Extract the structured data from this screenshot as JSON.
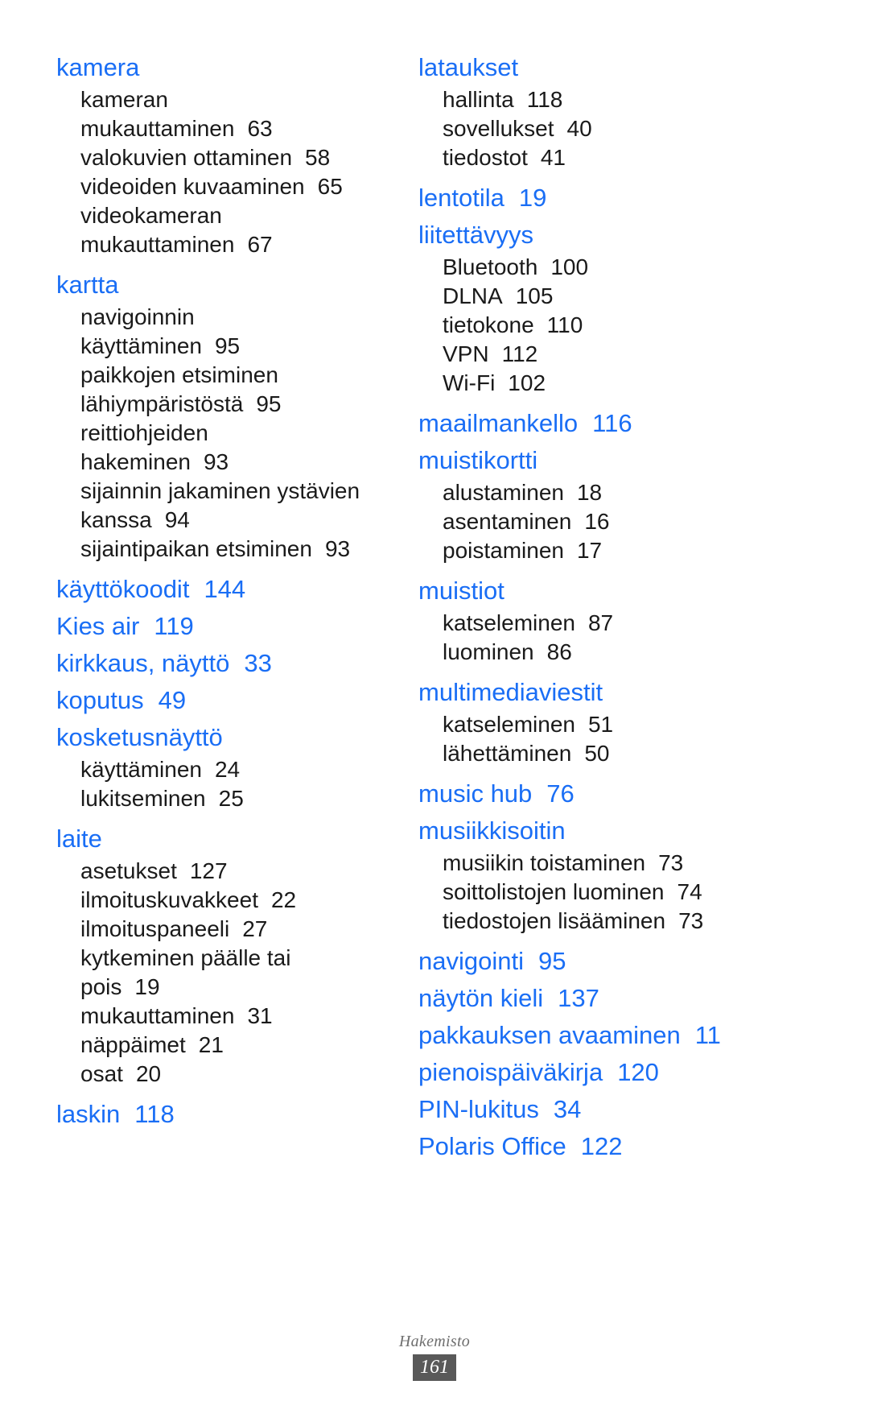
{
  "document": {
    "footer_label": "Hakemisto",
    "footer_page": "161",
    "accent_color": "#1a6ef5",
    "body_color": "#1a1a1a",
    "footer_badge_color": "#595959",
    "footer_label_color": "#6e6e6e"
  },
  "columns": [
    {
      "id": "left-column",
      "groups": [
        {
          "heading": "kamera",
          "heading_page": "",
          "subs": [
            {
              "lines": [
                "kameran",
                "mukauttaminen"
              ],
              "page": "63"
            },
            {
              "lines": [
                "valokuvien ottaminen"
              ],
              "page": "58"
            },
            {
              "lines": [
                "videoiden kuvaaminen"
              ],
              "page": "65"
            },
            {
              "lines": [
                "videokameran",
                "mukauttaminen"
              ],
              "page": "67"
            }
          ]
        },
        {
          "heading": "kartta",
          "heading_page": "",
          "subs": [
            {
              "lines": [
                "navigoinnin",
                "käyttäminen"
              ],
              "page": "95"
            },
            {
              "lines": [
                "paikkojen etsiminen",
                "lähiympäristöstä"
              ],
              "page": "95"
            },
            {
              "lines": [
                "reittiohjeiden",
                "hakeminen"
              ],
              "page": "93"
            },
            {
              "lines": [
                "sijainnin jakaminen ystävien",
                "kanssa"
              ],
              "page": "94"
            },
            {
              "lines": [
                "sijaintipaikan etsiminen"
              ],
              "page": "93"
            }
          ]
        },
        {
          "heading": "käyttökoodit",
          "heading_page": "144",
          "subs": []
        },
        {
          "heading": "Kies air",
          "heading_page": "119",
          "subs": []
        },
        {
          "heading": "kirkkaus, näyttö",
          "heading_page": "33",
          "subs": []
        },
        {
          "heading": "koputus",
          "heading_page": "49",
          "subs": []
        },
        {
          "heading": "kosketusnäyttö",
          "heading_page": "",
          "subs": [
            {
              "lines": [
                "käyttäminen"
              ],
              "page": "24"
            },
            {
              "lines": [
                "lukitseminen"
              ],
              "page": "25"
            }
          ]
        },
        {
          "heading": "laite",
          "heading_page": "",
          "subs": [
            {
              "lines": [
                "asetukset"
              ],
              "page": "127"
            },
            {
              "lines": [
                "ilmoituskuvakkeet"
              ],
              "page": "22"
            },
            {
              "lines": [
                "ilmoituspaneeli"
              ],
              "page": "27"
            },
            {
              "lines": [
                "kytkeminen päälle tai",
                "pois"
              ],
              "page": "19"
            },
            {
              "lines": [
                "mukauttaminen"
              ],
              "page": "31"
            },
            {
              "lines": [
                "näppäimet"
              ],
              "page": "21"
            },
            {
              "lines": [
                "osat"
              ],
              "page": "20"
            }
          ]
        },
        {
          "heading": "laskin",
          "heading_page": "118",
          "subs": []
        }
      ]
    },
    {
      "id": "right-column",
      "groups": [
        {
          "heading": "lataukset",
          "heading_page": "",
          "subs": [
            {
              "lines": [
                "hallinta"
              ],
              "page": "118"
            },
            {
              "lines": [
                "sovellukset"
              ],
              "page": "40"
            },
            {
              "lines": [
                "tiedostot"
              ],
              "page": "41"
            }
          ]
        },
        {
          "heading": "lentotila",
          "heading_page": "19",
          "subs": []
        },
        {
          "heading": "liitettävyys",
          "heading_page": "",
          "subs": [
            {
              "lines": [
                "Bluetooth"
              ],
              "page": "100"
            },
            {
              "lines": [
                "DLNA"
              ],
              "page": "105"
            },
            {
              "lines": [
                "tietokone"
              ],
              "page": "110"
            },
            {
              "lines": [
                "VPN"
              ],
              "page": "112"
            },
            {
              "lines": [
                "Wi-Fi"
              ],
              "page": "102"
            }
          ]
        },
        {
          "heading": "maailmankello",
          "heading_page": "116",
          "subs": []
        },
        {
          "heading": "muistikortti",
          "heading_page": "",
          "subs": [
            {
              "lines": [
                "alustaminen"
              ],
              "page": "18"
            },
            {
              "lines": [
                "asentaminen"
              ],
              "page": "16"
            },
            {
              "lines": [
                "poistaminen"
              ],
              "page": "17"
            }
          ]
        },
        {
          "heading": "muistiot",
          "heading_page": "",
          "subs": [
            {
              "lines": [
                "katseleminen"
              ],
              "page": "87"
            },
            {
              "lines": [
                "luominen"
              ],
              "page": "86"
            }
          ]
        },
        {
          "heading": "multimediaviestit",
          "heading_page": "",
          "subs": [
            {
              "lines": [
                "katseleminen"
              ],
              "page": "51"
            },
            {
              "lines": [
                "lähettäminen"
              ],
              "page": "50"
            }
          ]
        },
        {
          "heading": "music hub",
          "heading_page": "76",
          "subs": []
        },
        {
          "heading": "musiikkisoitin",
          "heading_page": "",
          "subs": [
            {
              "lines": [
                "musiikin toistaminen"
              ],
              "page": "73"
            },
            {
              "lines": [
                "soittolistojen luominen"
              ],
              "page": "74"
            },
            {
              "lines": [
                "tiedostojen lisääminen"
              ],
              "page": "73"
            }
          ]
        },
        {
          "heading": "navigointi",
          "heading_page": "95",
          "subs": []
        },
        {
          "heading": "näytön kieli",
          "heading_page": "137",
          "subs": []
        },
        {
          "heading": "pakkauksen avaaminen",
          "heading_page": "11",
          "subs": []
        },
        {
          "heading": "pienoispäiväkirja",
          "heading_page": "120",
          "subs": []
        },
        {
          "heading": "PIN-lukitus",
          "heading_page": "34",
          "subs": []
        },
        {
          "heading": "Polaris Office",
          "heading_page": "122",
          "subs": []
        }
      ]
    }
  ]
}
